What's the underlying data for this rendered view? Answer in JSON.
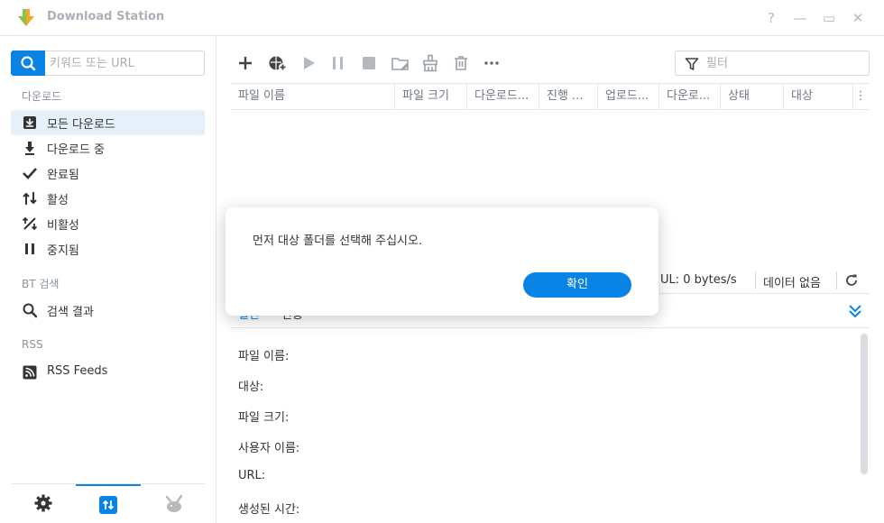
{
  "window": {
    "title": "Download Station",
    "help_label": "?",
    "minimize_label": "—",
    "maximize_label": "▭",
    "close_label": "✕"
  },
  "sidebar": {
    "search_placeholder": "키워드 또는 URL",
    "sections": {
      "download": "다운로드",
      "bt_search": "BT 검색",
      "rss": "RSS"
    },
    "items": [
      {
        "label": "모든 다운로드",
        "icon": "download-box-icon",
        "active": true
      },
      {
        "label": "다운로드 중",
        "icon": "arrow-down-icon"
      },
      {
        "label": "완료됨",
        "icon": "check-icon"
      },
      {
        "label": "활성",
        "icon": "arrows-updown-icon"
      },
      {
        "label": "비활성",
        "icon": "percent-icon"
      },
      {
        "label": "중지됨",
        "icon": "pause-icon"
      },
      {
        "label": "검색 결과",
        "icon": "search-icon"
      },
      {
        "label": "RSS Feeds",
        "icon": "rss-icon"
      }
    ],
    "bottom_tabs": [
      "gear-icon",
      "transfer-icon",
      "emule-icon"
    ]
  },
  "toolbar": {
    "filter_placeholder": "필터",
    "buttons": [
      "add-icon",
      "add-url-icon",
      "play-icon",
      "pause-icon",
      "stop-icon",
      "edit-folder-icon",
      "clean-icon",
      "delete-icon",
      "more-icon"
    ]
  },
  "table": {
    "columns": [
      "파일 이름",
      "파일 크기",
      "다운로드...",
      "진행 ...",
      "업로드...",
      "다운로...",
      "상태",
      "대상"
    ],
    "more_label": "⋮"
  },
  "status": {
    "upload": "UL: 0 bytes/s",
    "data": "데이터 없음"
  },
  "details": {
    "tabs": [
      "일반",
      "전송"
    ],
    "fields": [
      "파일 이름:",
      "대상:",
      "파일 크기:",
      "사용자 이름:",
      "URL:",
      "생성된 시간:"
    ]
  },
  "dialog": {
    "message": "먼저 대상 폴더를 선택해 주십시오.",
    "ok_label": "확인"
  },
  "colors": {
    "accent": "#0a84e4",
    "active_bg": "#e6f0fb"
  }
}
